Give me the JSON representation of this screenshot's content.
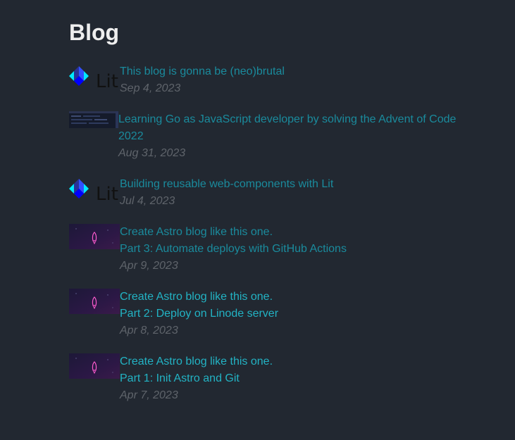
{
  "page": {
    "heading": "Blog"
  },
  "posts": [
    {
      "thumbnail_icon": "lit-logo-icon",
      "logo_text": "Lit",
      "title_lines": [
        "This blog is gonna be (neo)brutal"
      ],
      "date": "Sep 4, 2023"
    },
    {
      "thumbnail_icon": "code-screenshot-thumbnail",
      "title_lines": [
        "Learning Go as JavaScript developer by solving the Advent of Code 2022"
      ],
      "date": "Aug 31, 2023"
    },
    {
      "thumbnail_icon": "lit-logo-icon",
      "logo_text": "Lit",
      "title_lines": [
        "Building reusable web-components with Lit"
      ],
      "date": "Jul 4, 2023"
    },
    {
      "thumbnail_icon": "astro-rocket-thumbnail",
      "title_lines": [
        "Create Astro blog like this one.",
        "Part 3: Automate deploys with GitHub Actions"
      ],
      "date": "Apr 9, 2023"
    },
    {
      "thumbnail_icon": "astro-rocket-thumbnail",
      "title_lines": [
        "Create Astro blog like this one.",
        "Part 2: Deploy on Linode server"
      ],
      "date": "Apr 8, 2023"
    },
    {
      "thumbnail_icon": "astro-rocket-thumbnail",
      "title_lines": [
        "Create Astro blog like this one.",
        "Part 1: Init Astro and Git"
      ],
      "date": "Apr 7, 2023"
    }
  ],
  "colors": {
    "background": "#222831",
    "heading": "#eeeeee",
    "link": "#1a8b9d",
    "link_bright": "#22b3c4",
    "date": "#5f646b"
  }
}
